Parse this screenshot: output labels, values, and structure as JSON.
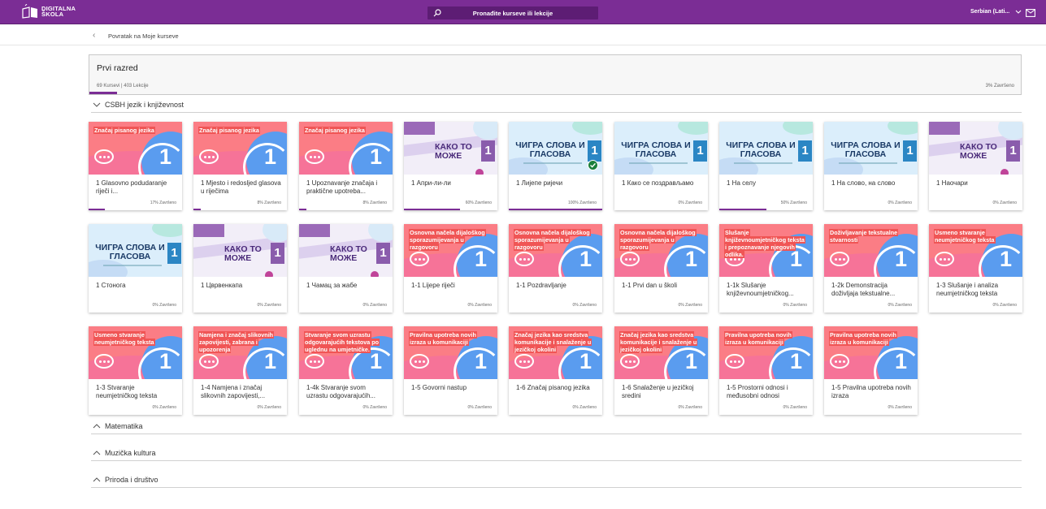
{
  "topbar": {
    "logo_line1": "DIGITALNA",
    "logo_line2": "ŠKOLA",
    "search_placeholder": "Pronađite kurseve ili lekcije",
    "language": "Serbian (Lati..."
  },
  "back_label": "Povratak na Moje kurseve",
  "course": {
    "title": "Prvi razred",
    "meta": "69 Kursevi | 403 Lekcije",
    "progress_label": "3% Završeno",
    "progress_fraction": 0.03
  },
  "sections": [
    {
      "title": "CSBH jezik i književnost",
      "expanded": true
    },
    {
      "title": "Matematika",
      "expanded": false
    },
    {
      "title": "Muzička kultura",
      "expanded": false
    },
    {
      "title": "Priroda i društvo",
      "expanded": false
    }
  ],
  "cards": [
    {
      "thumb": "red",
      "thumb_title": "Značaj pisanog jezika",
      "name": "1 Glasovno podudaranje riječi i...",
      "progress": "17% Završeno",
      "pct": 0.17
    },
    {
      "thumb": "red",
      "thumb_title": "Značaj pisanog jezika",
      "name": "1 Mjesto i redosljed glasova u riječima",
      "progress": "8% Završeno",
      "pct": 0.08
    },
    {
      "thumb": "red",
      "thumb_title": "Značaj pisanog jezika",
      "name": "1 Upoznavanje značaja i praktične upotreba...",
      "progress": "8% Završeno",
      "pct": 0.08
    },
    {
      "thumb": "purple",
      "thumb_title": "КАКО ТО МОЖЕ",
      "name": "1 Апри-ли-ли",
      "progress": "60% Završeno",
      "pct": 0.6
    },
    {
      "thumb": "blue",
      "thumb_title": "ЧИГРА СЛОВА И ГЛАСОВА",
      "name": "1 Лијепе ријечи",
      "progress": "100% Završeno",
      "pct": 1,
      "done": true
    },
    {
      "thumb": "blue",
      "thumb_title": "ЧИГРА СЛОВА И ГЛАСОВА",
      "name": "1 Како се поздрављамо",
      "progress": "0% Završeno",
      "pct": 0
    },
    {
      "thumb": "blue",
      "thumb_title": "ЧИГРА СЛОВА И ГЛАСОВА",
      "name": "1 На селу",
      "progress": "50% Završeno",
      "pct": 0.5
    },
    {
      "thumb": "blue",
      "thumb_title": "ЧИГРА СЛОВА И ГЛАСОВА",
      "name": "1 На слово, на слово",
      "progress": "0% Završeno",
      "pct": 0
    },
    {
      "thumb": "purple",
      "thumb_title": "КАКО ТО МОЖЕ",
      "name": "1 Наочари",
      "progress": "0% Završeno",
      "pct": 0
    },
    {
      "thumb": "blue",
      "thumb_title": "ЧИГРА СЛОВА И ГЛАСОВА",
      "name": "1 Стонога",
      "progress": "0% Završeno",
      "pct": 0
    },
    {
      "thumb": "purple",
      "thumb_title": "КАКО ТО МОЖЕ",
      "name": "1 Цврвенкапа",
      "progress": "0% Završeno",
      "pct": 0
    },
    {
      "thumb": "purple",
      "thumb_title": "КАКО ТО МОЖЕ",
      "name": "1 Чамац за жабе",
      "progress": "0% Završeno",
      "pct": 0
    },
    {
      "thumb": "red",
      "thumb_title": "Osnovna načela dijaloškog sporazumijevanja u razgovoru",
      "name": "1-1 Lijepe riječi",
      "progress": "0% Završeno",
      "pct": 0
    },
    {
      "thumb": "red",
      "thumb_title": "Osnovna načela dijaloškog sporazumijevanja u razgovoru",
      "name": "1-1 Pozdravljanje",
      "progress": "0% Završeno",
      "pct": 0
    },
    {
      "thumb": "red",
      "thumb_title": "Osnovna načela dijaloškog sporazumijevanja u razgovoru",
      "name": "1-1 Prvi dan u školi",
      "progress": "0% Završeno",
      "pct": 0
    },
    {
      "thumb": "red",
      "thumb_title": "Slušanje književnoumjetničkog teksta i prepoznavanje njegovih odlika.",
      "name": "1-1k Slušanje književnoumjetničkog...",
      "progress": "0% Završeno",
      "pct": 0
    },
    {
      "thumb": "red",
      "thumb_title": "Doživljavanje tekstualne stvarnosti",
      "name": "1-2k Demonstracija doživljaja tekstualne...",
      "progress": "0% Završeno",
      "pct": 0
    },
    {
      "thumb": "red",
      "thumb_title": "Usmeno stvaranje neumjetničkog teksta",
      "name": "1-3 Slušanje i analiza neumjetničkog teksta",
      "progress": "0% Završeno",
      "pct": 0
    },
    {
      "thumb": "red",
      "thumb_title": "Usmeno stvaranje neumjetničkog teksta",
      "name": "1-3 Stvaranje neumjetničkog teksta",
      "progress": "0% Završeno",
      "pct": 0
    },
    {
      "thumb": "red",
      "thumb_title": "Namjena i značaj slikovnih zapovijesti, zabrana i upozorenja",
      "name": "1-4 Namjena i značaj slikovnih zapovijesti,...",
      "progress": "0% Završeno",
      "pct": 0
    },
    {
      "thumb": "red",
      "thumb_title": "Stvaranje svom uzrastu odgovarajućih tekstova po uglednu na umjetničke.",
      "name": "1-4k Stvaranje svom uzrastu odgovarajućih...",
      "progress": "0% Završeno",
      "pct": 0
    },
    {
      "thumb": "red",
      "thumb_title": "Pravilna upotreba novih izraza u komunikaciji",
      "name": "1-5 Govorni nastup",
      "progress": "0% Završeno",
      "pct": 0
    },
    {
      "thumb": "red",
      "thumb_title": "Značaj jezika kao sredstva komunikacije i snalaženje u jezičkoj okolini",
      "name": "1-6 Značaj pisanog jezika",
      "progress": "0% Završeno",
      "pct": 0
    },
    {
      "thumb": "red",
      "thumb_title": "Značaj jezika kao sredstva komunikacije i snalaženje u jezičkoj okolini",
      "name": "1-6 Snalaženje u jezičkoj sredini",
      "progress": "0% Završeno",
      "pct": 0
    },
    {
      "thumb": "red",
      "thumb_title": "Pravilna upotreba novih izraza u komunikaciji",
      "name": "1-5 Prostorni odnosi i međusobni odnosi",
      "progress": "0% Završeno",
      "pct": 0
    },
    {
      "thumb": "red",
      "thumb_title": "Pravilna upotreba novih izraza u komunikaciji",
      "name": "1-5 Pravilna upotreba novih izraza",
      "progress": "0% Završeno",
      "pct": 0
    }
  ],
  "thumb_number": "1",
  "colors": {
    "brand": "#7b2d95",
    "thumb_red": "#fb7d85",
    "thumb_blue_circle": "#5a9cef",
    "done_check": "#1b7f3b"
  },
  "icons": [
    "book-logo-icon",
    "search-icon",
    "chevron-down-icon",
    "mail-icon",
    "chevron-left-icon",
    "chevron-up-icon",
    "chat-bubble-icon",
    "checkmark-icon"
  ]
}
